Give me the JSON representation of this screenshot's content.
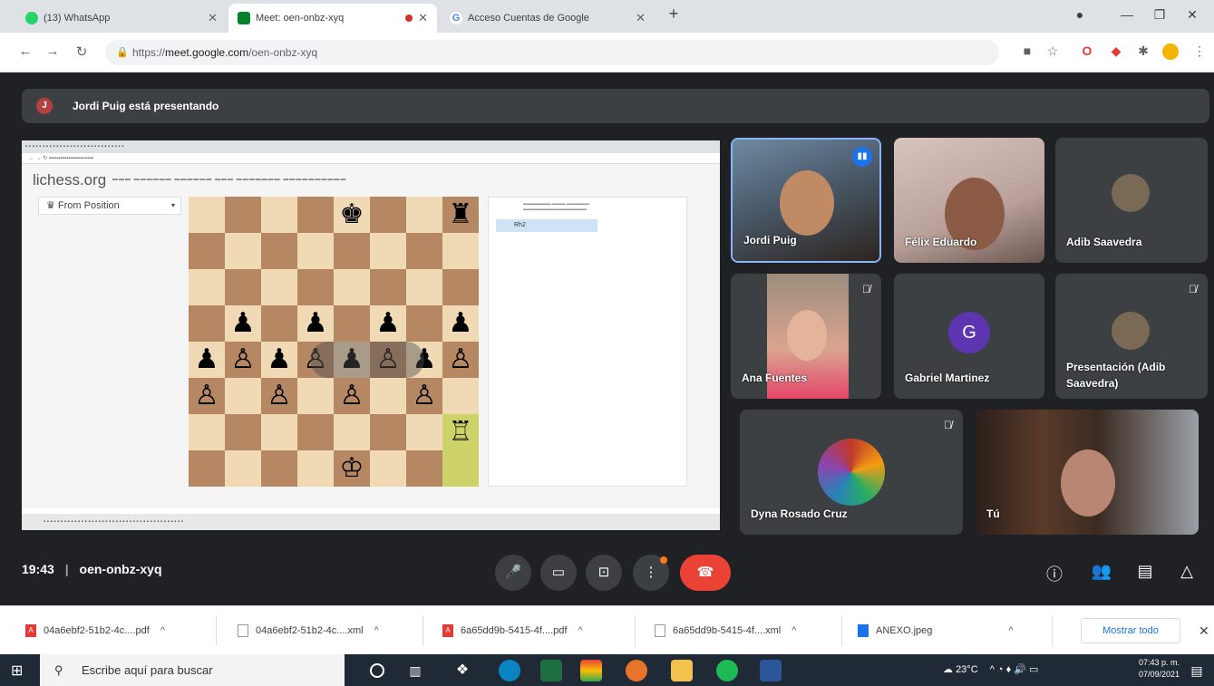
{
  "browser": {
    "tabs": [
      {
        "title": "(13) WhatsApp",
        "favicon_color": "#25d366"
      },
      {
        "title": "Meet: oen-onbz-xyq",
        "favicon_color": "#00832d",
        "active": true
      },
      {
        "title": "Acceso Cuentas de Google",
        "favicon_color": "#4285f4"
      }
    ],
    "new_tab": "+",
    "url_prefix": "https://",
    "url_host": "meet.google.com",
    "url_path": "/oen-onbz-xyq"
  },
  "meet": {
    "presenting_text": "Jordi Puig está presentando",
    "presenter_initial": "J",
    "meeting_time": "19:43",
    "meeting_code": "oen-onbz-xyq",
    "participants": [
      {
        "name": "Jordi Puig",
        "speaking": true
      },
      {
        "name": "Félix Eduardo"
      },
      {
        "name": "Adib Saavedra"
      },
      {
        "name": "Ana Fuentes",
        "muted": true
      },
      {
        "name": "Gabriel Martinez",
        "initial": "G",
        "avatar_color": "#5e35b1"
      },
      {
        "name": "Presentación (Adib Saavedra)",
        "muted": true
      },
      {
        "name": "Dyna Rosado Cruz",
        "muted": true
      },
      {
        "name": "Tú"
      }
    ]
  },
  "shared_screen": {
    "site_logo": "lichess.org",
    "variant_select": "From Position",
    "first_move": "Rh2",
    "board": [
      [
        "",
        "",
        "",
        "",
        "♚",
        "",
        "",
        "♜"
      ],
      [
        "",
        "",
        "",
        "",
        "",
        "",
        "",
        ""
      ],
      [
        "",
        "",
        "",
        "",
        "",
        "",
        "",
        ""
      ],
      [
        "",
        "♟",
        "",
        "♟",
        "",
        "♟",
        "",
        "♟"
      ],
      [
        "♟",
        "♙",
        "♟",
        "♙",
        "♟",
        "♙",
        "♟",
        "♙"
      ],
      [
        "♙",
        "",
        "♙",
        "",
        "♙",
        "",
        "♙",
        ""
      ],
      [
        "",
        "",
        "",
        "",
        "",
        "",
        "",
        "♖"
      ],
      [
        "",
        "",
        "",
        "",
        "♔",
        "",
        "",
        ""
      ]
    ]
  },
  "downloads": {
    "items": [
      {
        "name": "04a6ebf2-51b2-4c....pdf",
        "type": "pdf"
      },
      {
        "name": "04a6ebf2-51b2-4c....xml",
        "type": "xml"
      },
      {
        "name": "6a65dd9b-5415-4f....pdf",
        "type": "pdf"
      },
      {
        "name": "6a65dd9b-5415-4f....xml",
        "type": "xml"
      },
      {
        "name": "ANEXO.jpeg",
        "type": "jpeg"
      }
    ],
    "show_all": "Mostrar todo"
  },
  "taskbar": {
    "search_placeholder": "Escribe aquí para buscar",
    "temperature": "23°C",
    "time": "07:43 p. m.",
    "date": "07/09/2021"
  }
}
